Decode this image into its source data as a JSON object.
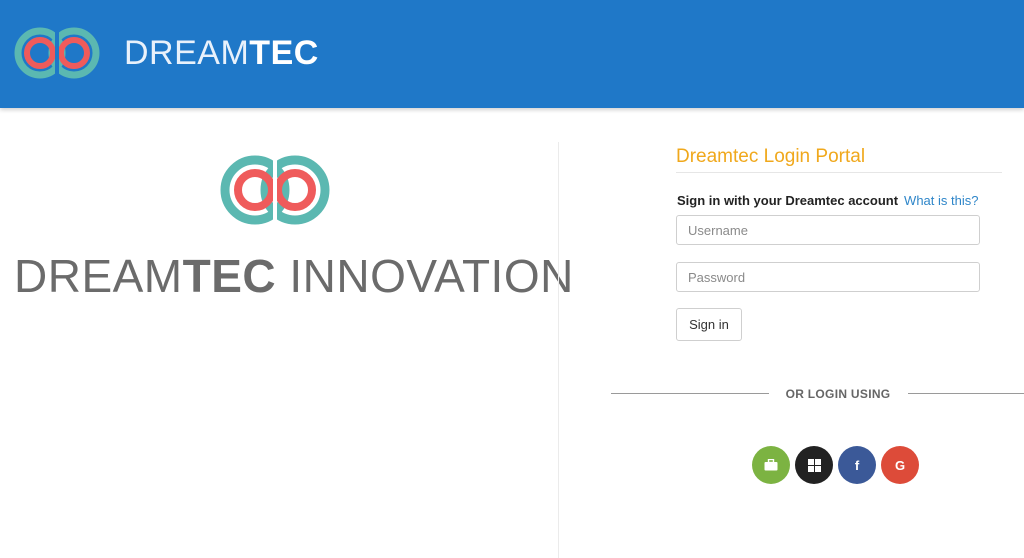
{
  "header": {
    "brand_light": "DREAM",
    "brand_bold": "TEC",
    "background": "#1f78c8"
  },
  "hero": {
    "text_light_1": "DREAM",
    "text_bold": "TEC",
    "text_light_2": " INNOVATION"
  },
  "login": {
    "title": "Dreamtec Login Portal",
    "signin_prompt": "Sign in with your Dreamtec account",
    "help_link": "What is this?",
    "username_placeholder": "Username",
    "password_placeholder": "Password",
    "signin_button": "Sign in",
    "or_login_using": "OR LOGIN USING"
  },
  "social": [
    {
      "name": "briefcase-icon",
      "color": "#7cb342"
    },
    {
      "name": "windows-icon",
      "color": "#222222"
    },
    {
      "name": "facebook-icon",
      "color": "#3b5998",
      "glyph": "f"
    },
    {
      "name": "google-icon",
      "color": "#dd4b39",
      "glyph": "G"
    }
  ],
  "colors": {
    "accent_orange": "#f0a81c",
    "link_blue": "#2f86c9",
    "logo_teal": "#5bb8b1",
    "logo_coral": "#ef5b5b"
  }
}
